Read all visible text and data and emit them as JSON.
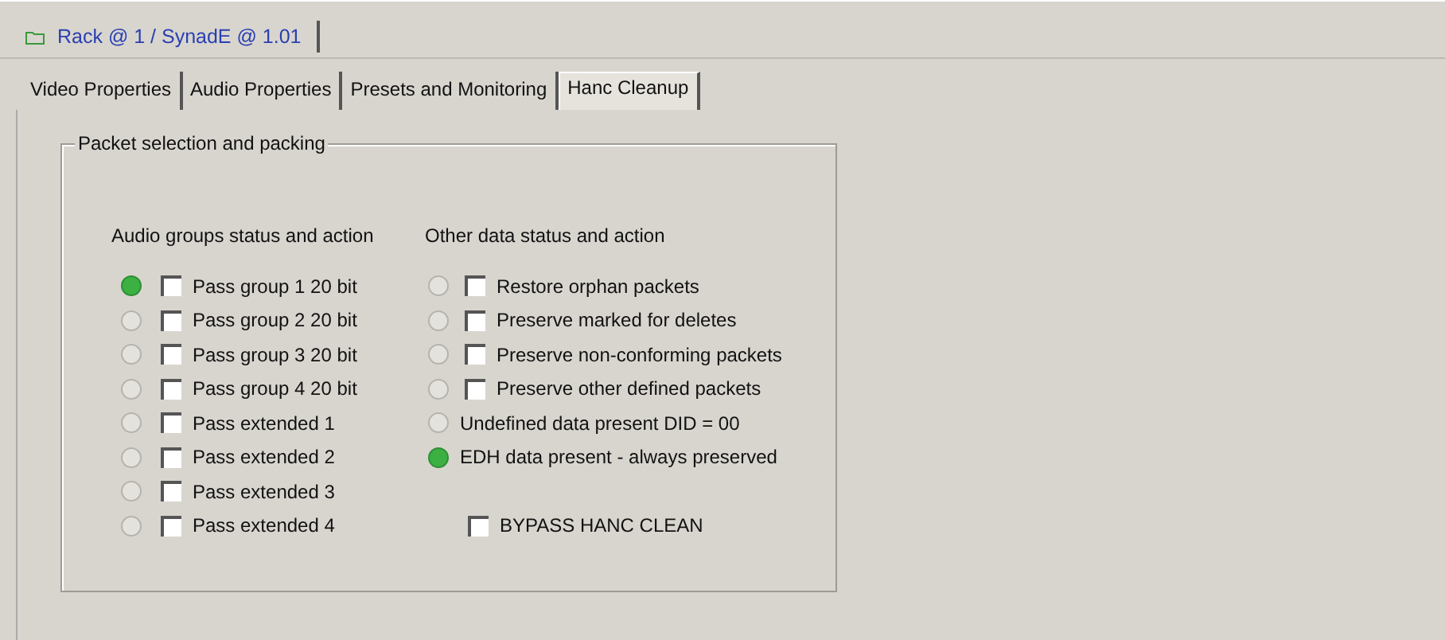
{
  "document_tab": {
    "title": "Rack @ 1 / SynadE @ 1.01"
  },
  "tabs": [
    {
      "label": "Video Properties",
      "selected": false
    },
    {
      "label": "Audio Properties",
      "selected": false
    },
    {
      "label": "Presets and Monitoring",
      "selected": false
    },
    {
      "label": "Hanc Cleanup",
      "selected": true
    }
  ],
  "group": {
    "title": "Packet selection and packing",
    "audio": {
      "heading": "Audio groups status and action",
      "rows": [
        {
          "label": "Pass group 1 20 bit",
          "lit": true,
          "checked": false
        },
        {
          "label": "Pass group 2 20 bit",
          "lit": false,
          "checked": false
        },
        {
          "label": "Pass group 3 20 bit",
          "lit": false,
          "checked": false
        },
        {
          "label": "Pass group 4 20 bit",
          "lit": false,
          "checked": false
        },
        {
          "label": "Pass extended 1",
          "lit": false,
          "checked": false
        },
        {
          "label": "Pass extended 2",
          "lit": false,
          "checked": false
        },
        {
          "label": "Pass extended 3",
          "lit": false,
          "checked": false
        },
        {
          "label": "Pass extended 4",
          "lit": false,
          "checked": false
        }
      ]
    },
    "other": {
      "heading": "Other data status and action",
      "rows": [
        {
          "kind": "checkbox",
          "label": "Restore orphan packets",
          "lit": false,
          "checked": false
        },
        {
          "kind": "checkbox",
          "label": "Preserve marked for deletes",
          "lit": false,
          "checked": false
        },
        {
          "kind": "checkbox",
          "label": "Preserve non-conforming packets",
          "lit": false,
          "checked": false
        },
        {
          "kind": "checkbox",
          "label": "Preserve other defined packets",
          "lit": false,
          "checked": false
        },
        {
          "kind": "status",
          "label": "Undefined data present DID = 00",
          "lit": false
        },
        {
          "kind": "status",
          "label": "EDH data present - always preserved",
          "lit": true
        }
      ],
      "bypass": {
        "label": "BYPASS HANC CLEAN",
        "checked": false
      }
    }
  }
}
